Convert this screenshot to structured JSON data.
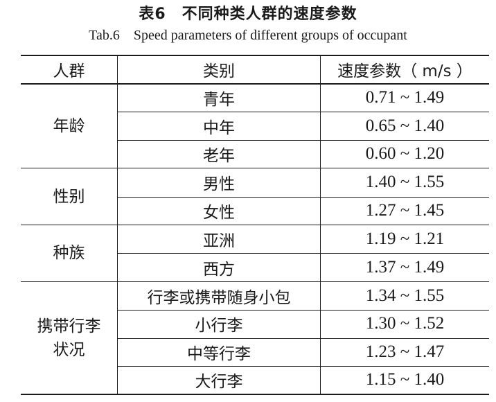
{
  "caption": {
    "title_cn": "表6　不同种类人群的速度参数",
    "title_en": "Tab.6　Speed parameters of different groups of occupant"
  },
  "table": {
    "headers": [
      "人群",
      "类别",
      "速度参数（ m/s ）"
    ],
    "groups": [
      {
        "label_lines": [
          "年龄"
        ],
        "rows": [
          {
            "category": "青年",
            "speed": "0.71 ~ 1.49"
          },
          {
            "category": "中年",
            "speed": "0.65 ~ 1.40"
          },
          {
            "category": "老年",
            "speed": "0.60 ~ 1.20"
          }
        ]
      },
      {
        "label_lines": [
          "性别"
        ],
        "rows": [
          {
            "category": "男性",
            "speed": "1.40 ~ 1.55"
          },
          {
            "category": "女性",
            "speed": "1.27 ~ 1.45"
          }
        ]
      },
      {
        "label_lines": [
          "种族"
        ],
        "rows": [
          {
            "category": "亚洲",
            "speed": "1.19 ~ 1.21"
          },
          {
            "category": "西方",
            "speed": "1.37 ~ 1.49"
          }
        ]
      },
      {
        "label_lines": [
          "携带行李",
          "状况"
        ],
        "rows": [
          {
            "category": "行李或携带随身小包",
            "speed": "1.34 ~ 1.55"
          },
          {
            "category": "小行李",
            "speed": "1.30 ~ 1.52"
          },
          {
            "category": "中等行李",
            "speed": "1.23 ~ 1.47"
          },
          {
            "category": "大行李",
            "speed": "1.15 ~ 1.40"
          }
        ]
      }
    ]
  }
}
